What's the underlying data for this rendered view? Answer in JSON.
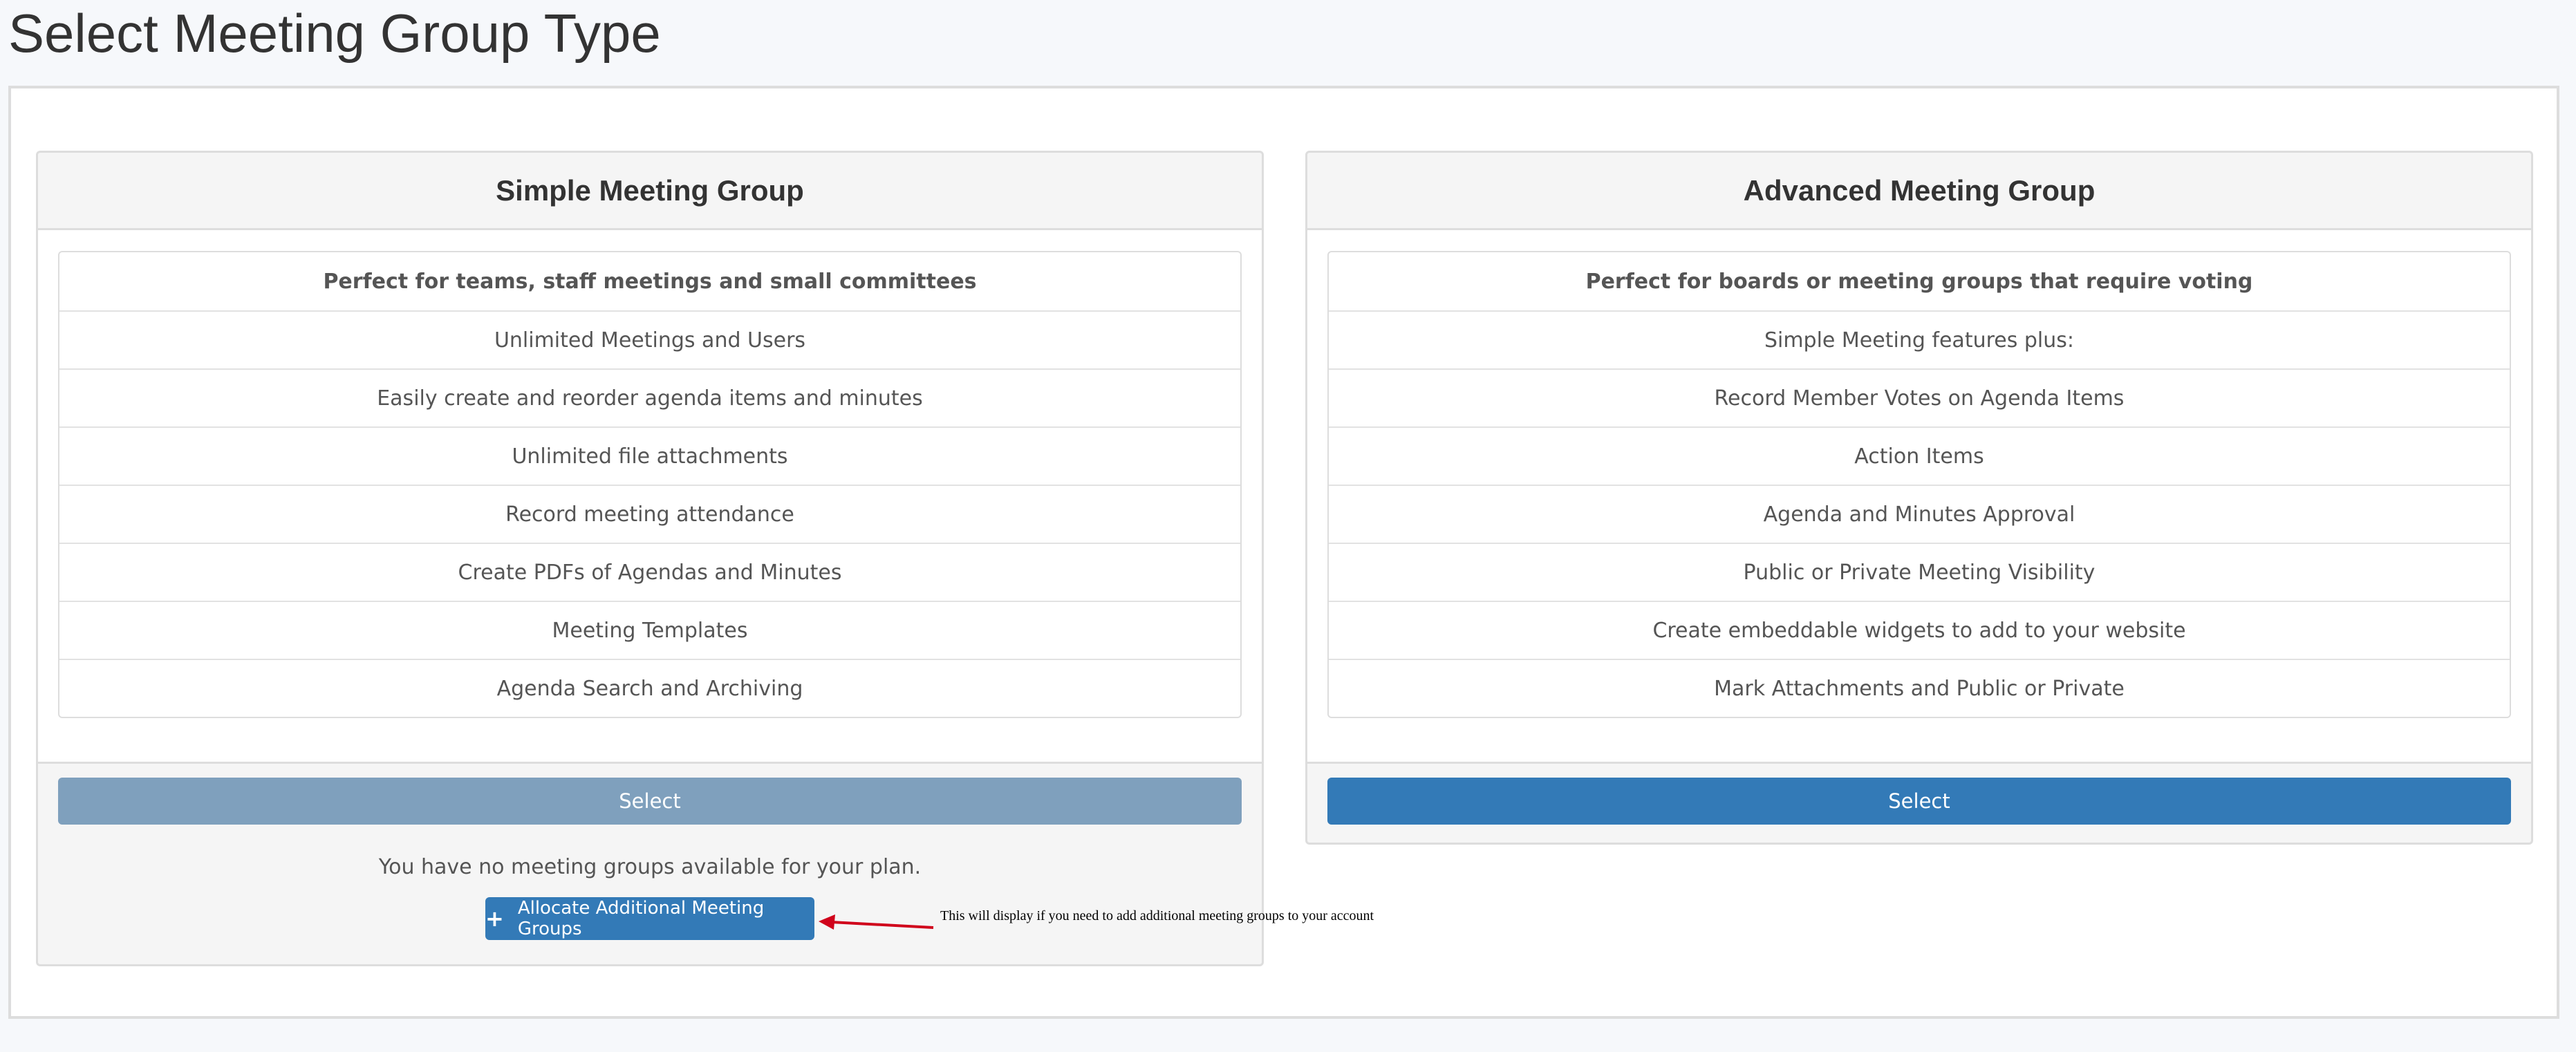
{
  "page": {
    "title": "Select Meeting Group Type"
  },
  "simple": {
    "title": "Simple Meeting Group",
    "features": [
      "Perfect for teams, staff meetings and small committees",
      "Unlimited Meetings and Users",
      "Easily create and reorder agenda items and minutes",
      "Unlimited file attachments",
      "Record meeting attendance",
      "Create PDFs of Agendas and Minutes",
      "Meeting Templates",
      "Agenda Search and Archiving"
    ],
    "select_label": "Select",
    "no_groups_note": "You have no meeting groups available for your plan.",
    "allocate_label": "Allocate Additional Meeting Groups"
  },
  "advanced": {
    "title": "Advanced Meeting Group",
    "features": [
      "Perfect for boards or meeting groups that require voting",
      "Simple Meeting features plus:",
      "Record Member Votes on Agenda Items",
      "Action Items",
      "Agenda and Minutes Approval",
      "Public or Private Meeting Visibility",
      "Create embeddable widgets to add to your website",
      "Mark Attachments and Public or Private"
    ],
    "select_label": "Select"
  },
  "annotation": {
    "text": "This will display if you need to add additional meeting groups to your account",
    "arrow_color": "#d0021b"
  },
  "colors": {
    "primary": "#337ab7",
    "disabled": "#7fa0bd"
  },
  "icons": {
    "allocate": "plus-icon"
  }
}
